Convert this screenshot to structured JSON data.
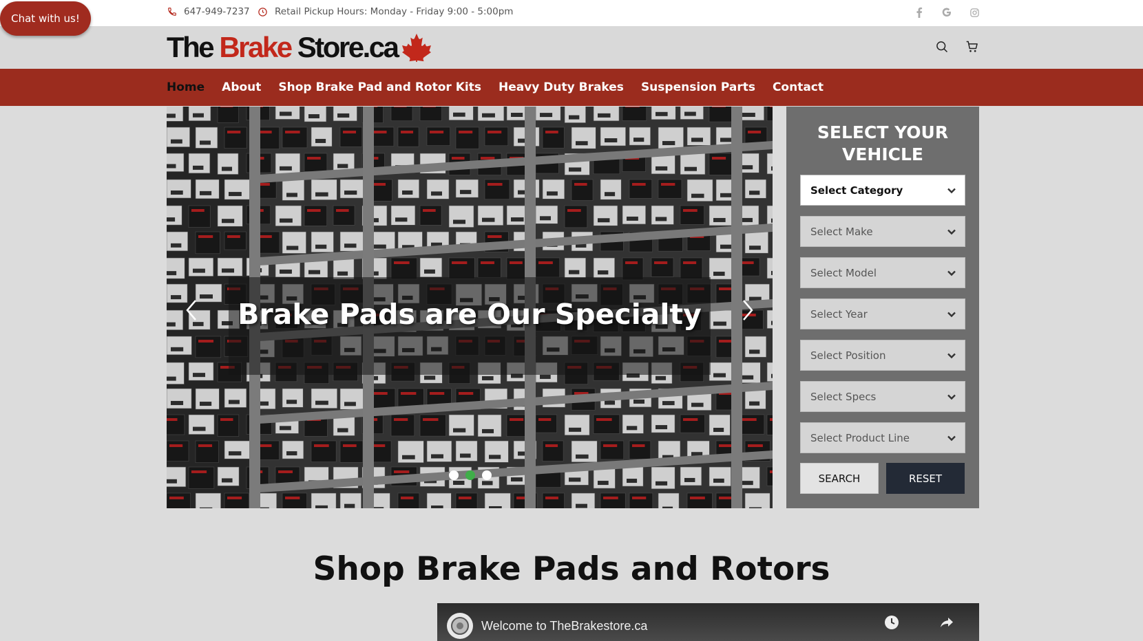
{
  "chat": {
    "label": "Chat with us!"
  },
  "topbar": {
    "phone": "647-949-7237",
    "hours": "Retail Pickup Hours: Monday - Friday 9:00 - 5:00pm",
    "social_icons": [
      "facebook-icon",
      "google-icon",
      "instagram-icon"
    ]
  },
  "logo": {
    "part1": "The ",
    "part2": "Brake",
    "part3": " Store.ca"
  },
  "header_icons": [
    "search-icon",
    "cart-icon"
  ],
  "nav": {
    "items": [
      {
        "label": "Home"
      },
      {
        "label": "About"
      },
      {
        "label": "Shop Brake Pad and Rotor Kits"
      },
      {
        "label": "Heavy Duty Brakes"
      },
      {
        "label": "Suspension Parts"
      },
      {
        "label": "Contact"
      }
    ],
    "active_index": 0
  },
  "hero": {
    "caption": "Brake Pads are Our Specialty",
    "slide_count": 3,
    "active_slide": 2
  },
  "vehicle_selector": {
    "title_line1": "SELECT YOUR",
    "title_line2": "VEHICLE",
    "selects": [
      {
        "label": "Select Category"
      },
      {
        "label": "Select Make"
      },
      {
        "label": "Select Model"
      },
      {
        "label": "Select Year"
      },
      {
        "label": "Select Position"
      },
      {
        "label": "Select Specs"
      },
      {
        "label": "Select Product Line"
      }
    ],
    "search_label": "SEARCH",
    "reset_label": "RESET"
  },
  "section": {
    "title": "Shop Brake Pads and Rotors"
  },
  "video": {
    "title": "Welcome to TheBrakestore.ca"
  },
  "colors": {
    "brand_red": "#9b2c1e",
    "logo_red": "#c2281b",
    "panel_gray": "#6e6e6e",
    "reset_navy": "#232a36",
    "active_dot": "#3fae49"
  }
}
